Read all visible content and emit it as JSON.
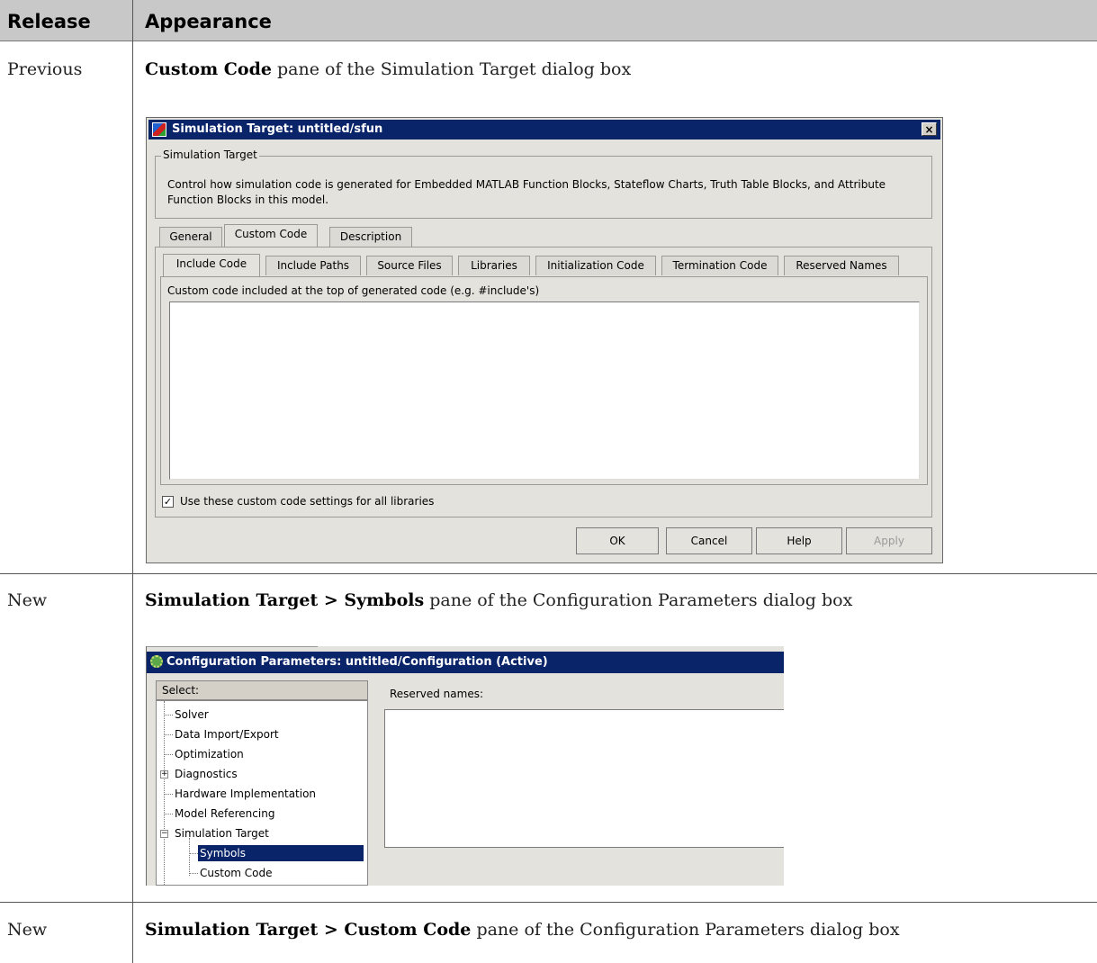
{
  "table": {
    "headers": [
      "Release",
      "Appearance"
    ],
    "rows": [
      {
        "release": "Previous",
        "appearance_bold": "Custom Code",
        "appearance_rest": " pane of the Simulation Target dialog box"
      },
      {
        "release": "New",
        "appearance_bold": "Simulation Target > Symbols",
        "appearance_rest": " pane of the Configuration Parameters dialog box"
      },
      {
        "release": "New",
        "appearance_bold": "Simulation Target > Custom Code",
        "appearance_rest": " pane of the Configuration Parameters dialog box"
      }
    ]
  },
  "dialog1": {
    "title": "Simulation Target: untitled/sfun",
    "close": "×",
    "group_title": "Simulation Target",
    "group_text": "Control how simulation code is generated for Embedded MATLAB Function Blocks, Stateflow Charts, Truth Table Blocks, and Attribute Function Blocks in this model.",
    "tabs": [
      "General",
      "Custom Code",
      "Description"
    ],
    "subtabs": [
      "Include Code",
      "Include Paths",
      "Source Files",
      "Libraries",
      "Initialization Code",
      "Termination Code",
      "Reserved Names"
    ],
    "code_label": "Custom code included at the top of generated code (e.g. #include's)",
    "checkbox_mark": "✓",
    "checkbox_label": "Use these custom code settings for all libraries",
    "buttons": {
      "ok": "OK",
      "cancel": "Cancel",
      "help": "Help",
      "apply": "Apply"
    }
  },
  "dialog2": {
    "title": "Configuration Parameters: untitled/Configuration (Active)",
    "select_label": "Select:",
    "tree": [
      "Solver",
      "Data Import/Export",
      "Optimization",
      "Diagnostics",
      "Hardware Implementation",
      "Model Referencing",
      "Simulation Target",
      "Symbols",
      "Custom Code"
    ],
    "expand_plus": "+",
    "expand_minus": "−",
    "reserved_label": "Reserved names:"
  }
}
